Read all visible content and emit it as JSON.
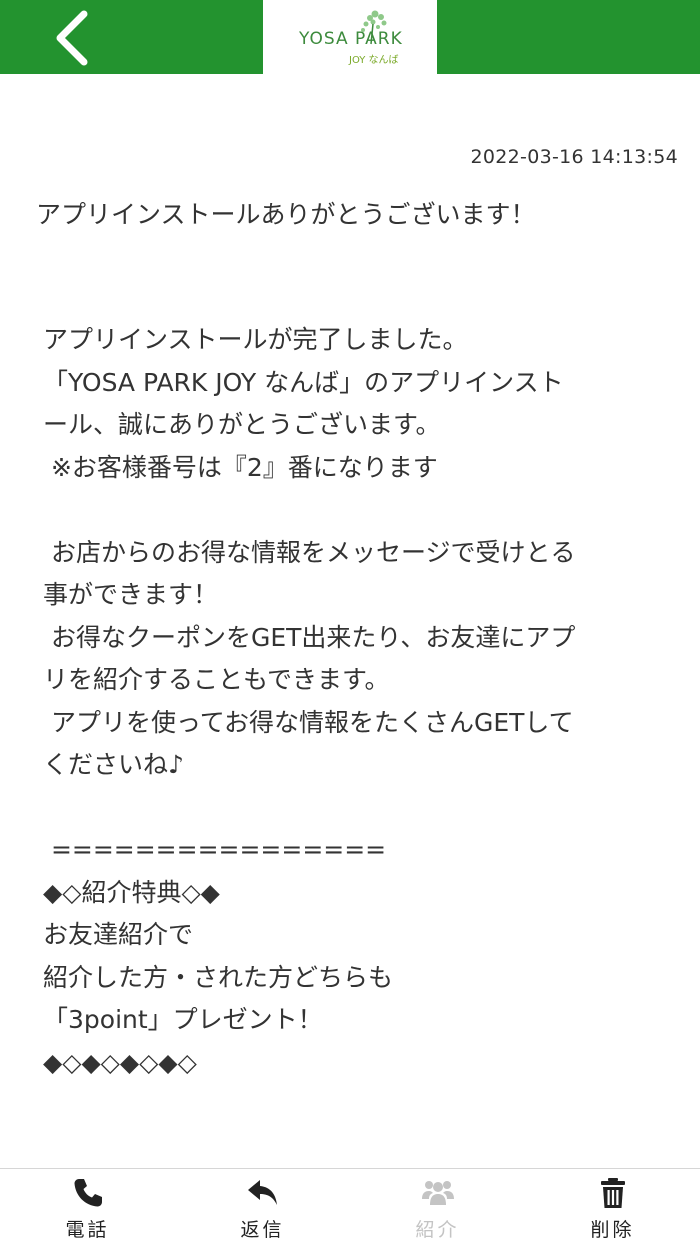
{
  "header": {
    "back_icon": "chevron-left-icon",
    "logo": {
      "main": "YOSA PARK",
      "sub": "JOY なんば"
    },
    "colors": {
      "bar": "#23932f",
      "logo_green": "#3d8b3d"
    }
  },
  "message": {
    "timestamp": "2022-03-16 14:13:54",
    "title": "アプリインストールありがとうございます！",
    "lines": [
      "アプリインストールが完了しました。",
      "「YOSA PARK JOY なんば」のアプリインスト",
      "ール、誠にありがとうございます。",
      " ※お客様番号は『2』番になります",
      "",
      " お店からのお得な情報をメッセージで受けとる",
      "事ができます！",
      " お得なクーポンをGET出来たり、お友達にアプ",
      "リを紹介することもできます。",
      " アプリを使ってお得な情報をたくさんGETして",
      "くださいね♪",
      "",
      " ================",
      "◆◇紹介特典◇◆",
      "お友達紹介で",
      "紹介した方・された方どちらも",
      "「3point」プレゼント！",
      "◆◇◆◇◆◇◆◇"
    ]
  },
  "tabbar": {
    "items": [
      {
        "label": "電話",
        "icon": "phone-icon",
        "enabled": true
      },
      {
        "label": "返信",
        "icon": "reply-icon",
        "enabled": true
      },
      {
        "label": "紹介",
        "icon": "group-icon",
        "enabled": false
      },
      {
        "label": "削除",
        "icon": "trash-icon",
        "enabled": true
      }
    ]
  }
}
